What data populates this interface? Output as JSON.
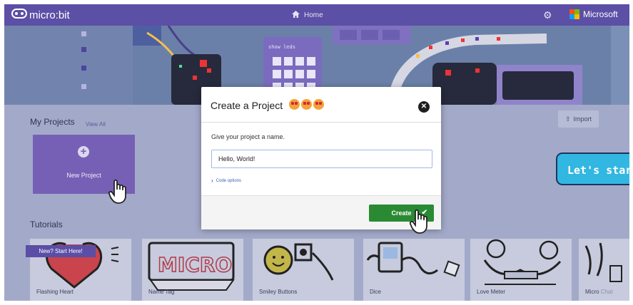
{
  "header": {
    "brand": "micro:bit",
    "home_label": "Home",
    "microsoft_label": "Microsoft"
  },
  "my_projects": {
    "title": "My Projects",
    "view_all": "View All",
    "import_label": "Import",
    "new_project_label": "New Project"
  },
  "tutorials": {
    "title": "Tutorials",
    "badge": "New? Start Here!",
    "cards": [
      {
        "label": "Flashing Heart"
      },
      {
        "label": "Name Tag"
      },
      {
        "label": "Smiley Buttons"
      },
      {
        "label": "Dice"
      },
      {
        "label": "Love Meter"
      },
      {
        "label": "Micro",
        "label_faint": "Chat"
      }
    ]
  },
  "banner": {
    "blocks_label": "show leds"
  },
  "modal": {
    "title": "Create a Project",
    "emoji": "star-struck-face",
    "prompt": "Give your project a name.",
    "input_value": "Hello, World!",
    "code_options": "Code options",
    "create_label": "Create"
  },
  "callout": "Let's start",
  "colors": {
    "topbar": "#5c4fa6",
    "new_project_tile": "#7660b5",
    "create_button": "#2a8a33",
    "callout": "#31b7e1"
  }
}
